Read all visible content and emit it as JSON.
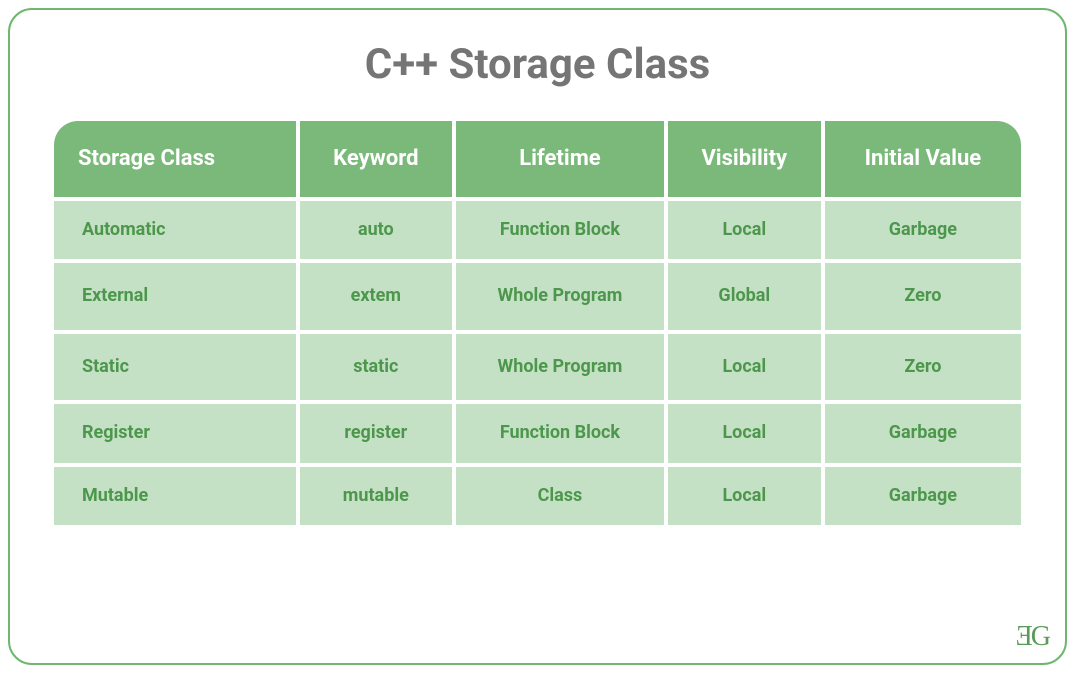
{
  "title": "C++ Storage Class",
  "logo": "ƎG",
  "table": {
    "headers": [
      "Storage Class",
      "Keyword",
      "Lifetime",
      "Visibility",
      "Initial Value"
    ],
    "rows": [
      {
        "storage_class": "Automatic",
        "keyword": "auto",
        "lifetime": "Function Block",
        "visibility": "Local",
        "initial_value": "Garbage"
      },
      {
        "storage_class": "External",
        "keyword": "extem",
        "lifetime": "Whole Program",
        "visibility": "Global",
        "initial_value": "Zero"
      },
      {
        "storage_class": "Static",
        "keyword": "static",
        "lifetime": "Whole Program",
        "visibility": "Local",
        "initial_value": "Zero"
      },
      {
        "storage_class": "Register",
        "keyword": "register",
        "lifetime": "Function Block",
        "visibility": "Local",
        "initial_value": "Garbage"
      },
      {
        "storage_class": "Mutable",
        "keyword": "mutable",
        "lifetime": "Class",
        "visibility": "Local",
        "initial_value": "Garbage"
      }
    ]
  }
}
